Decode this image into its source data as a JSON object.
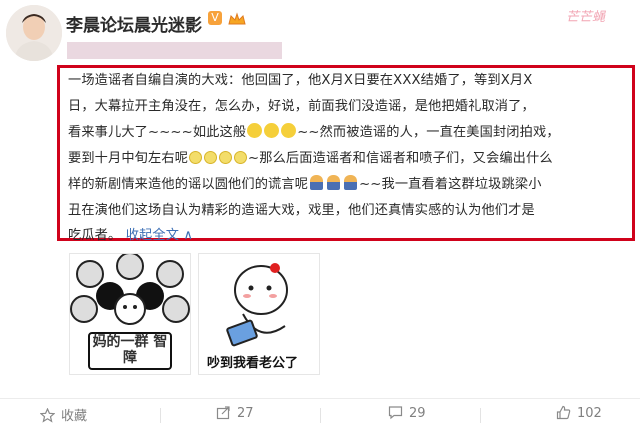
{
  "header": {
    "username": "李晨论坛晨光迷影",
    "watermark": "芒芒蝇"
  },
  "post": {
    "lines": [
      "一场造谣者自编自演的大戏：他回国了，他X月X日要在XXX结婚了，等到X月X",
      "日，大幕拉开主角没在，怎么办，好说，前面我们没造谣，是他把婚礼取消了，",
      "看来事儿大了~~~~如此这般",
      "~~然而被造谣的人，一直在美国封闭拍戏，",
      "要到十月中旬左右呢",
      "~那么后面造谣者和信谣者和喷子们，又会编出什么",
      "样的新剧情来造他的谣以圆他们的谎言呢",
      "~~我一直看着这群垃圾跳梁小",
      "丑在演他们这场自认为精彩的造谣大戏，戏里，他们还真情实感的认为他们才是",
      "吃瓜者。",
      "收起全文 ∧"
    ]
  },
  "images": {
    "meme1_caption": "妈的一群 智障",
    "meme2_caption": "吵到我看老公了"
  },
  "footer": {
    "favorite_label": "收藏",
    "repost_count": "27",
    "comment_count": "29",
    "like_count": "102"
  },
  "colors": {
    "highlight_border": "#d0021b",
    "link": "#3c6fb5"
  }
}
